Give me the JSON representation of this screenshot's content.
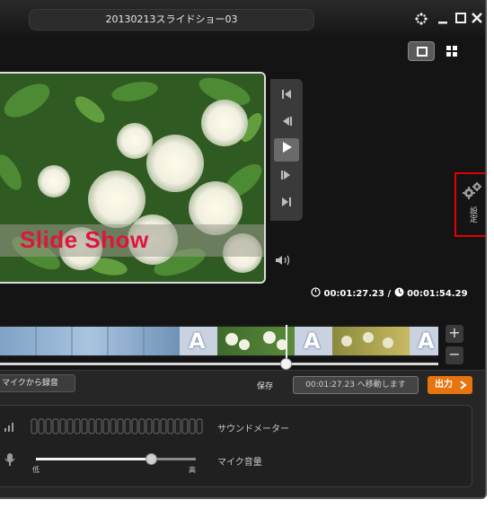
{
  "window": {
    "title": "20130213スライドショー03"
  },
  "window_controls": [
    "spinner-icon",
    "minimize-icon",
    "maximize-icon",
    "close-icon"
  ],
  "view_modes": [
    {
      "name": "single-view",
      "active": true
    },
    {
      "name": "grid-view",
      "active": false
    }
  ],
  "preview": {
    "overlay_text": "Slide Show",
    "overlay_color": "#e0143c"
  },
  "playback_controls": [
    "skip-to-start-icon",
    "previous-frame-icon",
    "play-icon",
    "next-frame-icon",
    "skip-to-end-icon"
  ],
  "settings": {
    "label": "設定"
  },
  "time": {
    "current": "00:01:27.23",
    "separator": "/",
    "total": "00:01:54.29"
  },
  "timeline": {
    "text_clip_letter": "A",
    "playhead_fraction": 0.65
  },
  "zoom": {
    "in": "+",
    "out": "−"
  },
  "audio": {
    "record_button": "マイクから録音",
    "save_label": "保存",
    "save_hint_text": "00:01:27.23 へ移動します",
    "export_button": "出力",
    "sound_meter_label": "サウンドメーター",
    "mic_volume_label": "マイク音量",
    "low_label": "低",
    "high_label": "高",
    "mic_volume_fraction": 0.72
  },
  "colors": {
    "accent_orange": "#e87410",
    "highlight_red": "#e00000"
  }
}
